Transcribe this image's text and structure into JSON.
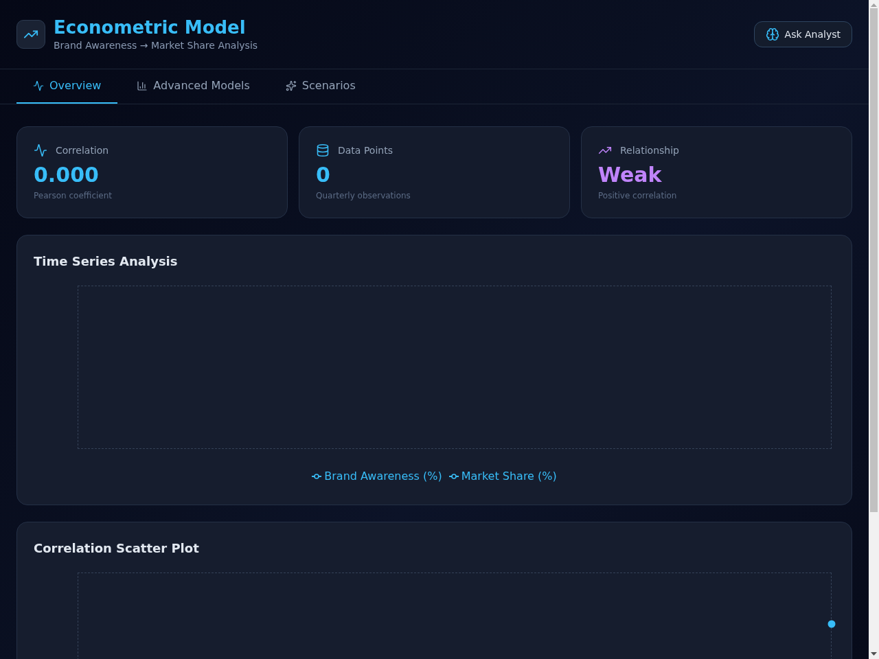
{
  "header": {
    "title": "Econometric Model",
    "subtitle": "Brand Awareness → Market Share Analysis",
    "action_button": "Ask Analyst"
  },
  "tabs": [
    {
      "label": "Overview",
      "selected": true
    },
    {
      "label": "Advanced Models",
      "selected": false
    },
    {
      "label": "Scenarios",
      "selected": false
    }
  ],
  "stats": [
    {
      "kind": "correlation",
      "label": "Correlation",
      "value": "0.000",
      "caption": "Pearson coefficient",
      "color": "#38bdf8"
    },
    {
      "kind": "count",
      "label": "Data Points",
      "value": "0",
      "caption": "Quarterly observations",
      "color": "#38bdf8"
    },
    {
      "kind": "relationship",
      "label": "Relationship",
      "value": "Weak",
      "caption": "Positive correlation",
      "color": "#c084fc"
    }
  ],
  "time_series": {
    "title": "Time Series Analysis",
    "legend": [
      {
        "label": "Brand Awareness (%)"
      },
      {
        "label": "Market Share (%)"
      }
    ]
  },
  "scatter_plot": {
    "title": "Correlation Scatter Plot"
  }
}
